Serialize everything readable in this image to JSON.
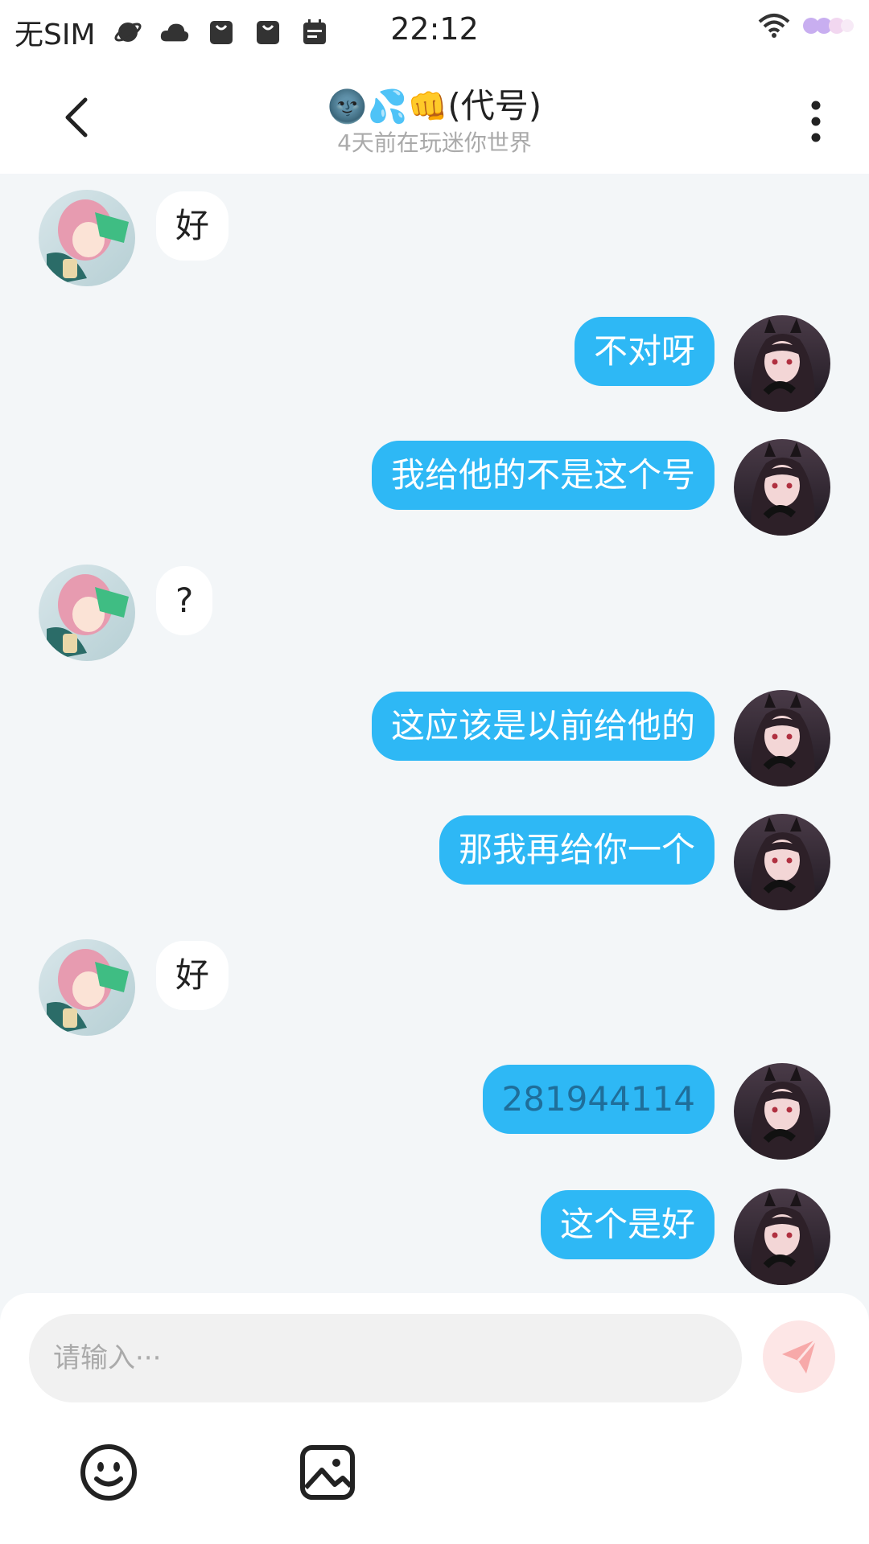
{
  "status_bar": {
    "carrier": "无SIM",
    "time": "22:12",
    "icons": [
      "planet-icon",
      "cloud-icon",
      "shopping-bag-icon",
      "shopping-bag-icon",
      "calendar-icon",
      "wifi-icon",
      "battery-icon"
    ]
  },
  "header": {
    "title_emoji": "🌚💦👊",
    "title_text": "(代号)",
    "subtitle": "4天前在玩迷你世界",
    "back_icon": "chevron-left-icon",
    "more_icon": "more-vertical-icon"
  },
  "messages": [
    {
      "side": "in",
      "text": "好"
    },
    {
      "side": "out",
      "text": "不对呀"
    },
    {
      "side": "out",
      "text": "我给他的不是这个号"
    },
    {
      "side": "in",
      "text": "?"
    },
    {
      "side": "out",
      "text": "这应该是以前给他的"
    },
    {
      "side": "out",
      "text": "那我再给你一个"
    },
    {
      "side": "in",
      "text": "好"
    },
    {
      "side": "out",
      "text": "281944114"
    },
    {
      "side": "out",
      "text": "这个是好"
    }
  ],
  "composer": {
    "placeholder": "请输入···",
    "send_icon": "send-icon",
    "emoji_icon": "smiley-icon",
    "image_icon": "image-icon"
  },
  "colors": {
    "outgoing_bubble": "#2eb8f5",
    "incoming_bubble": "#ffffff",
    "background": "#f3f6f8",
    "send_button": "#fde6e6"
  }
}
